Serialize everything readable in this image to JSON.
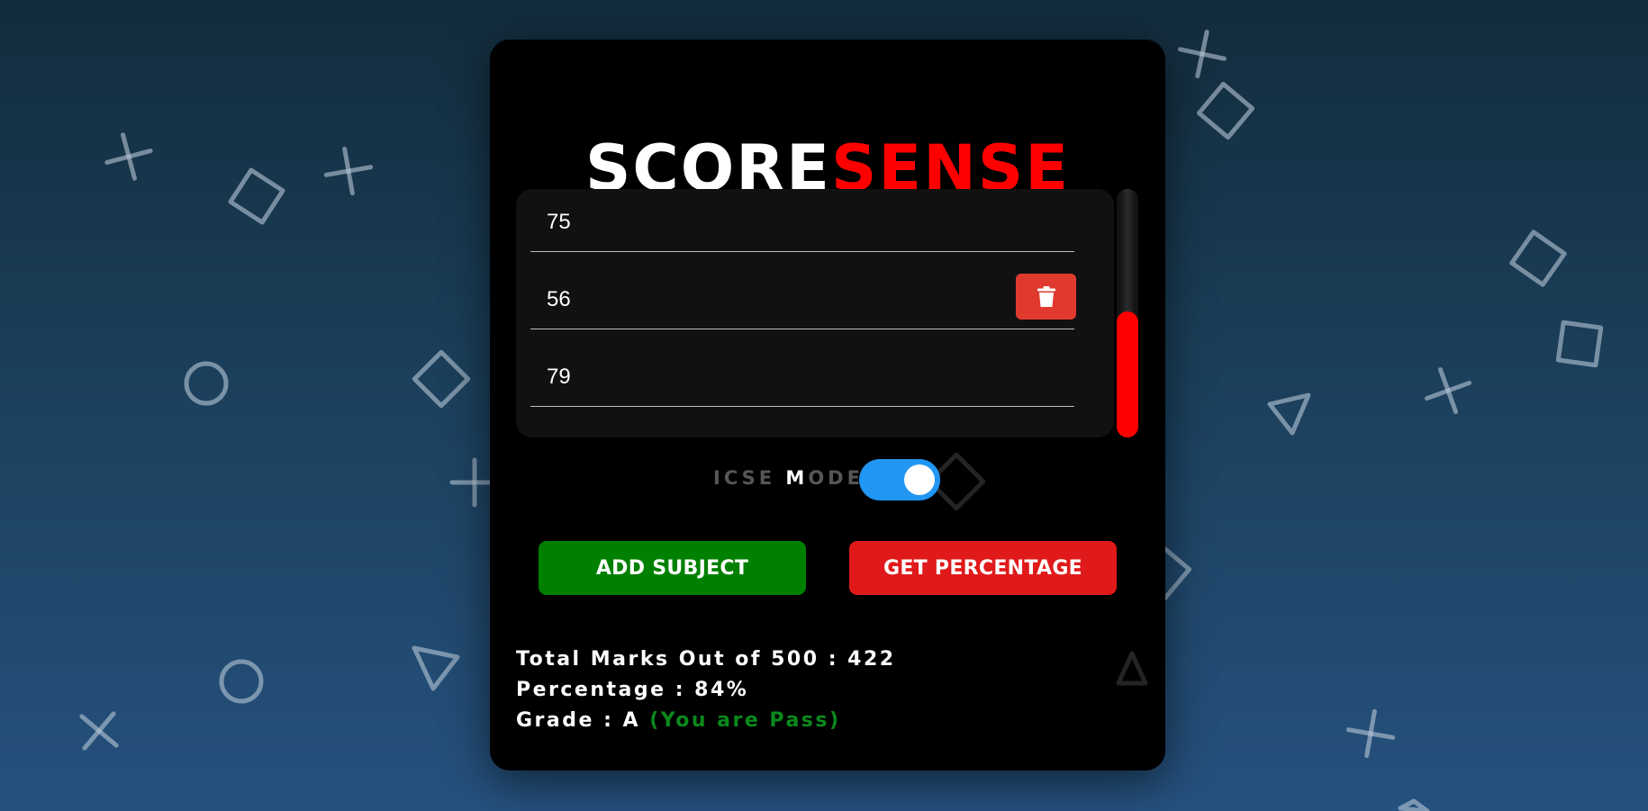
{
  "app": {
    "title_part1": "SCORE",
    "title_part2": "SENSE"
  },
  "subjects": [
    {
      "value": "75",
      "has_delete": false
    },
    {
      "value": "56",
      "has_delete": true
    },
    {
      "value": "79",
      "has_delete": false
    }
  ],
  "icons": {
    "delete": "trash-icon"
  },
  "mode": {
    "label_start": "ICSE ",
    "label_highlight": "M",
    "label_end": "ODE",
    "enabled": true
  },
  "buttons": {
    "add_subject": "ADD SUBJECT",
    "get_percentage": "GET PERCENTAGE"
  },
  "results": {
    "total_line": "Total Marks Out of 500 : 422",
    "percentage_line": "Percentage : 84%",
    "grade_line": "Grade : A",
    "status": "(You are Pass)"
  },
  "colors": {
    "brand_red": "#ff0000",
    "add_green": "#008000",
    "get_red": "#e01a1a",
    "delete_red": "#e03a2e",
    "toggle_blue": "#2196f3",
    "pass_green": "#0a8a1c"
  }
}
